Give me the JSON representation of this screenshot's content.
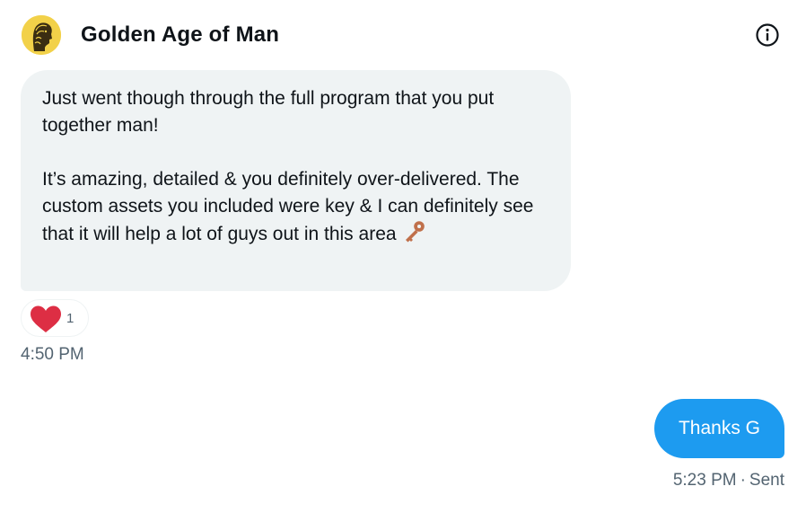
{
  "header": {
    "title": "Golden Age of Man",
    "avatar_icon": "golden-bust-avatar",
    "info_icon": "info-circle-icon"
  },
  "messages": [
    {
      "direction": "incoming",
      "paragraphs": [
        "Just went though through the full program that you put together man!",
        "It’s amazing, detailed & you definitely over-delivered. The custom assets you included were key & I can definitely see that it will help a lot of guys out in this area"
      ],
      "trailing_emoji": "key-emoji",
      "reaction": {
        "icon": "red-heart-icon",
        "count": "1"
      },
      "time": "4:50 PM"
    },
    {
      "direction": "outgoing",
      "text": "Thanks G",
      "time": "5:23 PM",
      "separator": "·",
      "status": "Sent"
    }
  ],
  "colors": {
    "incoming_bubble": "#eff3f4",
    "outgoing_bubble": "#1d9bf0",
    "secondary_text": "#536471",
    "heart": "#f91880",
    "key": "#c0704b"
  }
}
